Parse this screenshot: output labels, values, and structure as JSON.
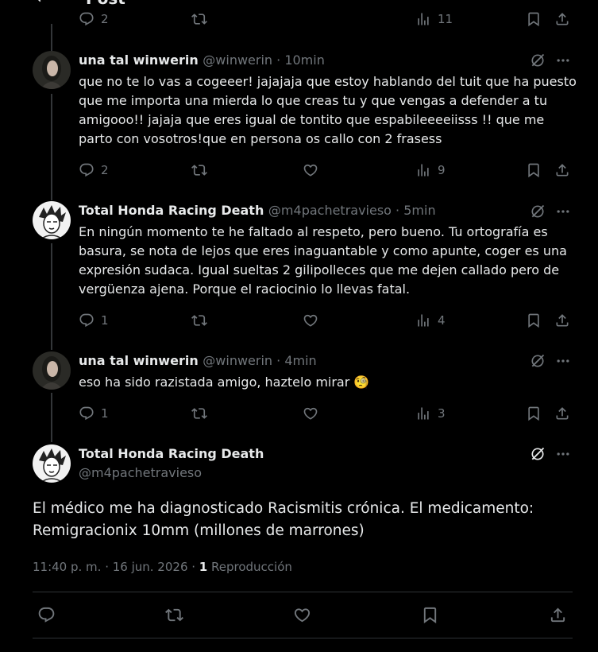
{
  "header": {
    "title": "Post"
  },
  "top_actions": {
    "replies": "2",
    "views": "11"
  },
  "replies": [
    {
      "name": "una tal winwerin",
      "handle": "@winwerin",
      "time": "10min",
      "text": "que no te lo vas a cogeeer! jajajaja que estoy hablando del tuit que ha puesto que me importa una mierda lo que creas tu y que vengas a defender a tu amigooo!! jajaja que eres igual de tontito que espabileeeeiisss !! que me parto con vosotros!que en persona os callo con 2 frasess",
      "replies": "2",
      "views": "9"
    },
    {
      "name": "Total Honda Racing Death",
      "handle": "@m4pachetravieso",
      "time": "5min",
      "text": "En ningún momento te he faltado al respeto, pero bueno. Tu ortografía es basura, se nota de lejos que eres inaguantable y como apunte, coger es una expresión sudaca. Igual sueltas 2 gilipolleces que me dejen callado pero de vergüenza ajena. Porque el raciocinio lo llevas fatal.",
      "replies": "1",
      "views": "4"
    },
    {
      "name": "una tal winwerin",
      "handle": "@winwerin",
      "time": "4min",
      "text": "eso ha sido razistada amigo, haztelo mirar",
      "emoji": "🧐",
      "replies": "1",
      "views": "3"
    }
  ],
  "main_post": {
    "name": "Total Honda Racing Death",
    "handle": "@m4pachetravieso",
    "text_line1": "El médico me ha diagnosticado Racismitis crónica. El medicamento:",
    "text_line2": "Remigracionix 10mm (millones de marrones)",
    "timestamp": "11:40 p. m. · 16 jun. 2026 · ",
    "plays_count": "1",
    "plays_label": " Reproducción"
  },
  "colors": {
    "background": "#000000",
    "text": "#e7e9ea",
    "muted": "#71767b",
    "border": "#2f3336"
  },
  "icons": [
    "back-arrow-icon",
    "reply-icon",
    "repost-icon",
    "like-icon",
    "views-icon",
    "bookmark-icon",
    "share-icon",
    "grok-icon",
    "more-icon"
  ]
}
